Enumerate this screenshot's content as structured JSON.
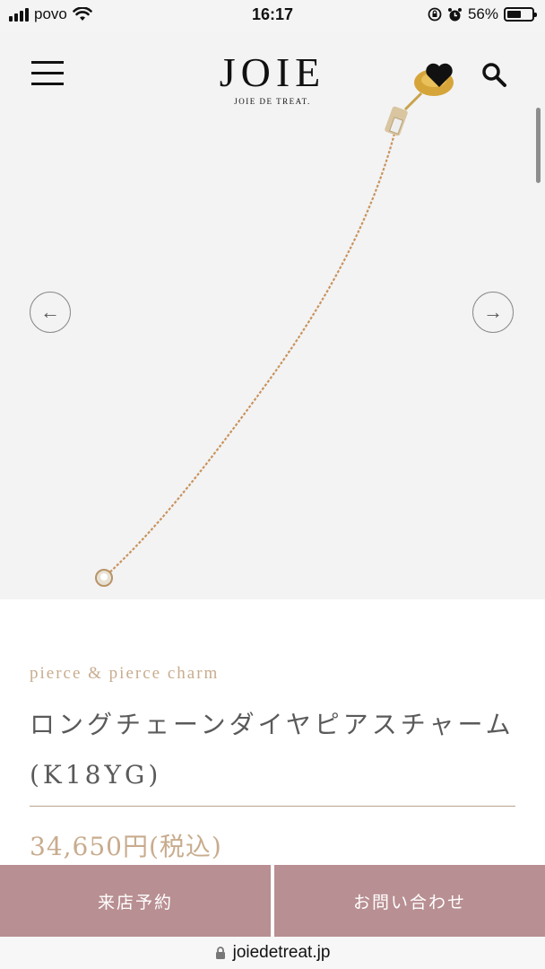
{
  "status_bar": {
    "carrier": "povo",
    "time": "16:17",
    "battery": "56%",
    "battery_level": 0.56
  },
  "header": {
    "logo": "JOIE",
    "logo_sub": "JOIE DE TREAT.",
    "menu_icon": "hamburger-icon",
    "favorite_icon": "heart-icon",
    "search_icon": "search-icon"
  },
  "gallery": {
    "prev_label": "←",
    "next_label": "→"
  },
  "product": {
    "category": "pierce & pierce charm",
    "title": "ロングチェーンダイヤピアスチャーム(K18YG)",
    "price": "34,650円(税込)"
  },
  "actions": {
    "reserve_label": "来店予約",
    "contact_label": "お問い合わせ"
  },
  "browser": {
    "url": "joiedetreat.jp"
  },
  "colors": {
    "accent": "#c8ac8e",
    "cta": "#b88f92"
  }
}
